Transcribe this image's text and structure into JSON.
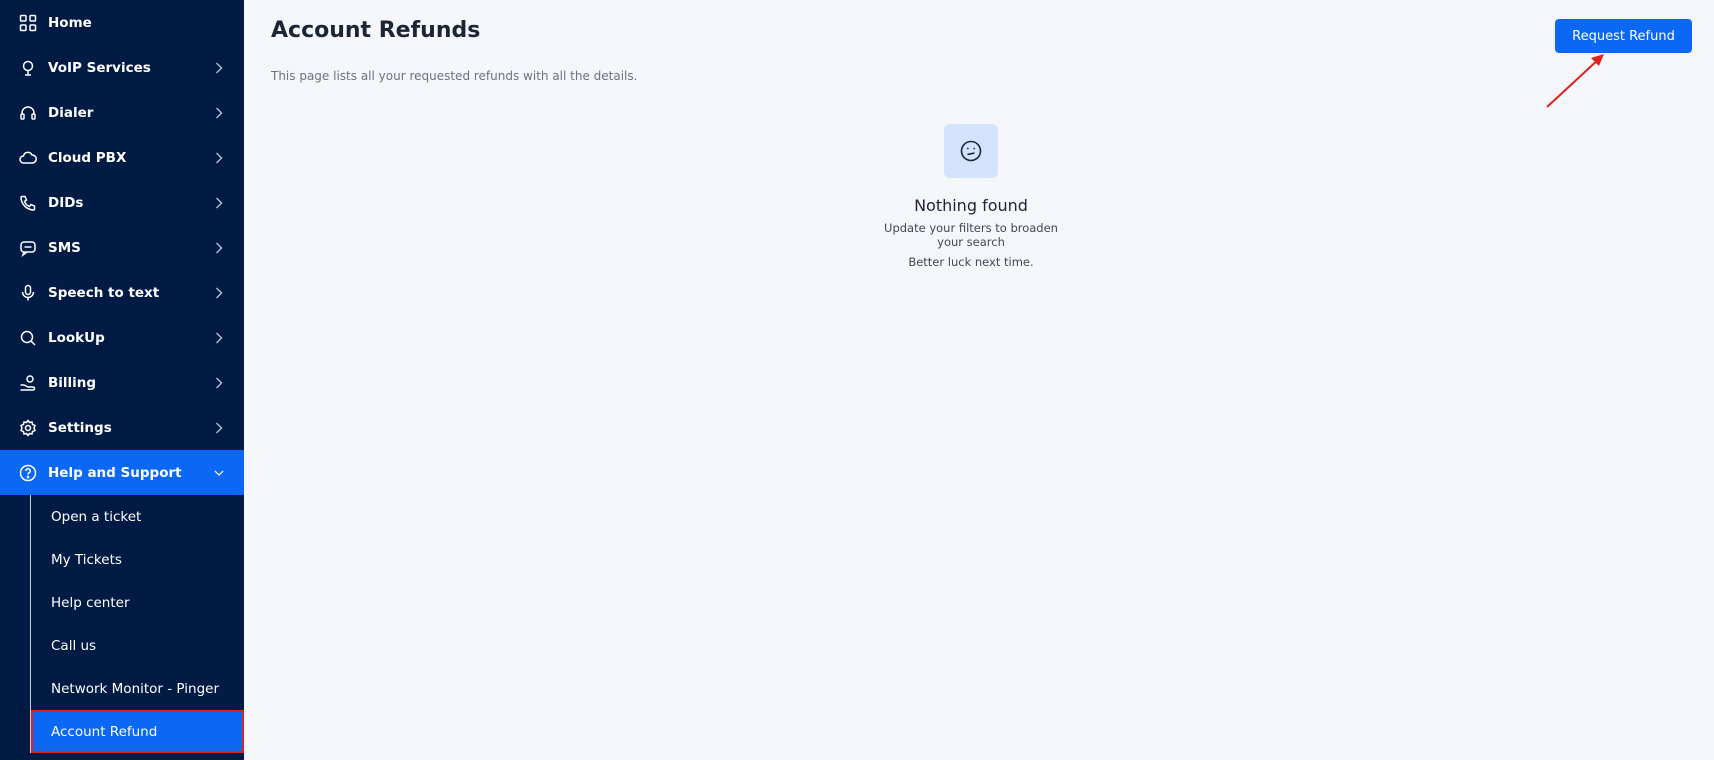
{
  "sidebar": {
    "items": [
      {
        "label": "Home",
        "icon": "grid-icon",
        "has_chevron": false
      },
      {
        "label": "VoIP Services",
        "icon": "voip-icon",
        "has_chevron": true
      },
      {
        "label": "Dialer",
        "icon": "headset-icon",
        "has_chevron": true
      },
      {
        "label": "Cloud PBX",
        "icon": "cloud-phone-icon",
        "has_chevron": true
      },
      {
        "label": "DIDs",
        "icon": "phone-icon",
        "has_chevron": true
      },
      {
        "label": "SMS",
        "icon": "message-icon",
        "has_chevron": true
      },
      {
        "label": "Speech to text",
        "icon": "microphone-icon",
        "has_chevron": true
      },
      {
        "label": "LookUp",
        "icon": "search-icon",
        "has_chevron": true
      },
      {
        "label": "Billing",
        "icon": "billing-hand-icon",
        "has_chevron": true
      },
      {
        "label": "Settings",
        "icon": "gear-icon",
        "has_chevron": true
      },
      {
        "label": "Help and Support",
        "icon": "help-circle-icon",
        "has_chevron": true,
        "active": true
      }
    ],
    "subitems": [
      {
        "label": "Open a ticket"
      },
      {
        "label": "My Tickets"
      },
      {
        "label": "Help center"
      },
      {
        "label": "Call us"
      },
      {
        "label": "Network Monitor - Pinger"
      },
      {
        "label": "Account Refund",
        "active": true
      }
    ]
  },
  "main": {
    "title": "Account Refunds",
    "subtitle": "This page lists all your requested refunds with all the details.",
    "request_button": "Request Refund",
    "empty_state": {
      "icon": "confused-face-icon",
      "title": "Nothing found",
      "line1": "Update your filters to broaden your search",
      "line2": "Better luck next time."
    }
  },
  "colors": {
    "sidebar_bg": "#021b44",
    "accent": "#0a68f5",
    "highlight_annotation": "#e4201f",
    "page_bg": "#f5f6fa"
  }
}
